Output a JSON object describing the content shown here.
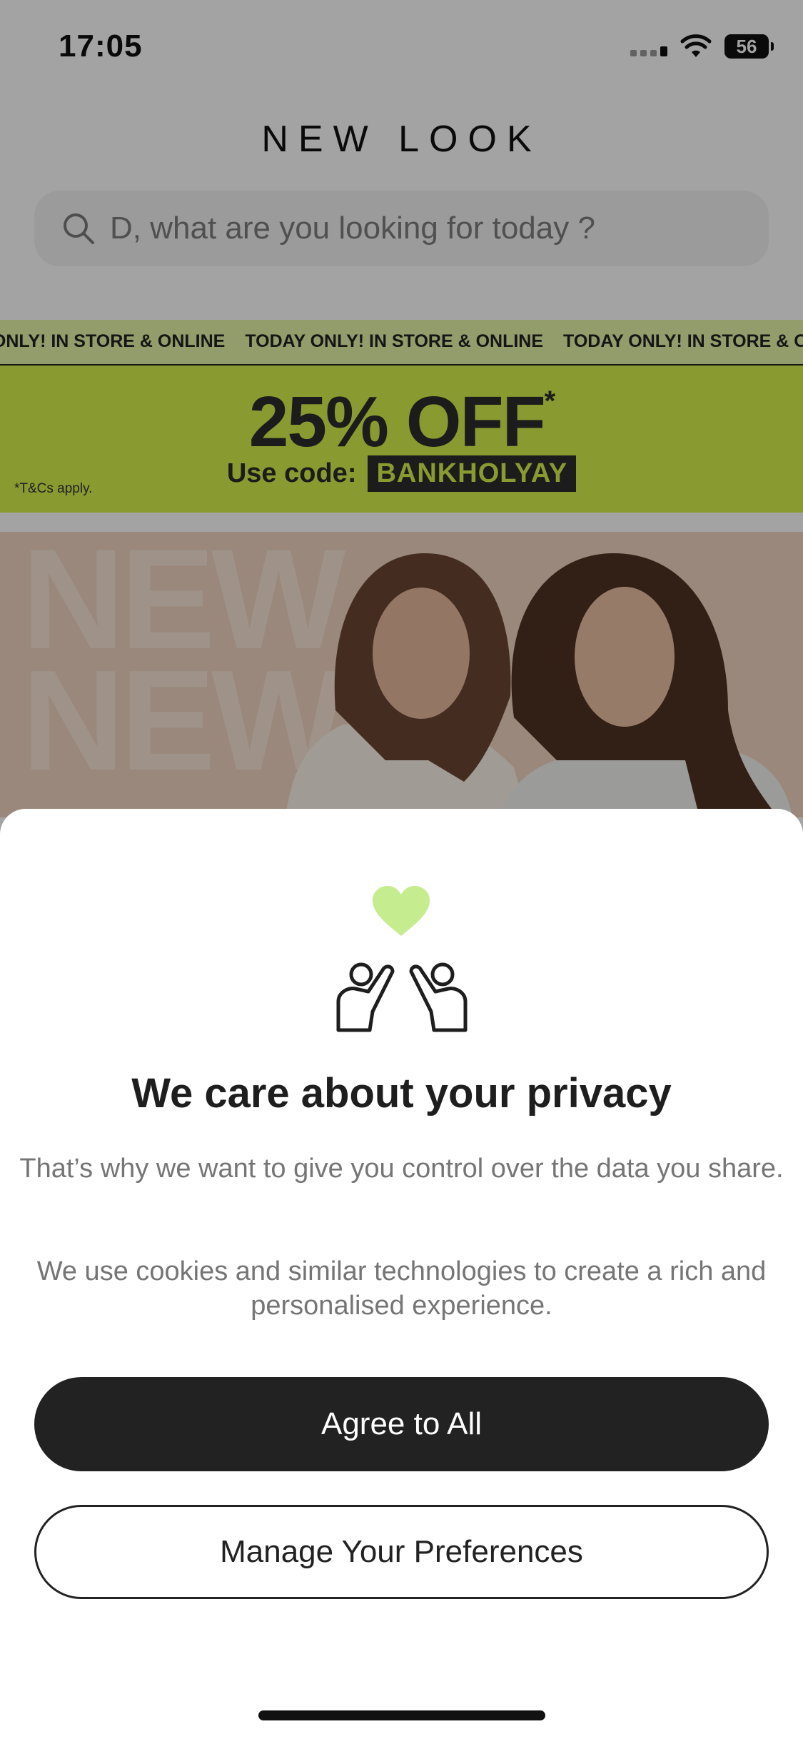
{
  "status_bar": {
    "time": "17:05",
    "battery": "56"
  },
  "header": {
    "brand": "NEW LOOK",
    "search_placeholder": "D, what are you looking for today ?"
  },
  "promo": {
    "ticker": [
      "AY ONLY! IN STORE & ONLINE",
      "TODAY ONLY! IN STORE & ONLINE",
      "TODAY ONLY! IN STORE & ONLINE"
    ],
    "headline": "25% OFF",
    "headline_mark": "*",
    "code_label": "Use code:",
    "code": "BANKHOLYAY",
    "terms": "*T&Cs apply.",
    "accent_color": "#d6f24b"
  },
  "hero": {
    "background_word": "NEW"
  },
  "consent": {
    "heart_icon": "heart-icon",
    "people_icon": "high-five-icon",
    "title": "We care about your privacy",
    "body_1": "That’s why we want to give you control over the data you share.",
    "body_2": "We use cookies and similar technologies to create a rich and personalised experience.",
    "agree_label": "Agree to All",
    "manage_label": "Manage Your Preferences"
  }
}
